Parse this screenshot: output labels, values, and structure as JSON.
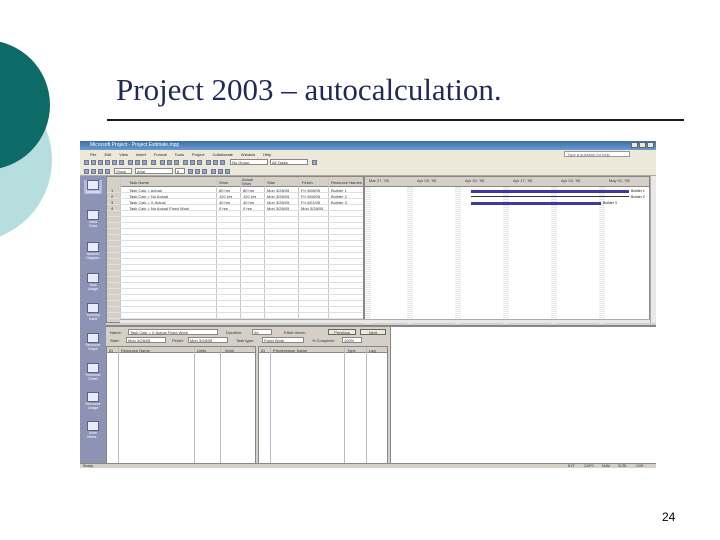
{
  "slide": {
    "title": "Project 2003 – autocalculation.",
    "page_number": "24"
  },
  "app": {
    "window_title": "Microsoft Project - Project Estimate.mpp",
    "menu": [
      "File",
      "Edit",
      "View",
      "Insert",
      "Format",
      "Tools",
      "Project",
      "Collaborate",
      "Window",
      "Help"
    ],
    "help_placeholder": "Type a question for help",
    "toolbar": {
      "group": "No Group",
      "filter": "All Tasks",
      "font": "Arial",
      "size": "8",
      "show": "Show"
    },
    "views": [
      "Calendar",
      "Gantt Chart",
      "Network Diagram",
      "Task Usage",
      "Tracking Gantt",
      "Resource Graph",
      "Resource Sheet",
      "Resource Usage",
      "More Views..."
    ],
    "task_table": {
      "columns": [
        "",
        "Task Name",
        "Work",
        "Actual Work",
        "Start",
        "Finish",
        "Resource Names"
      ],
      "rows": [
        [
          "1",
          "Task Calc = Actual",
          "80 hrs",
          "80 hrs",
          "Mon 3/28/05",
          "Fri 4/08/05",
          "Builder 1"
        ],
        [
          "2",
          "Task Calc = No Actual",
          "120 hrs",
          "120 hrs",
          "Mon 3/28/05",
          "Fri 4/08/05",
          "Builder 2"
        ],
        [
          "3",
          "Task Calc = X Actual",
          "40 hrs",
          "40 hrs",
          "Mon 3/28/05",
          "Fri 4/01/05",
          "Builder 3"
        ],
        [
          "4",
          "Task Calc = No Actual Fixed Work",
          "0 hrs",
          "0 hrs",
          "Mon 3/28/05",
          "Mon 3/28/05",
          ""
        ]
      ]
    },
    "gantt": {
      "weeks": [
        "Mar 27, '05",
        "Apr 03, '05",
        "Apr 10, '05",
        "Apr 17, '05",
        "Apr 24, '05",
        "May 01, '05"
      ],
      "bar_labels": [
        "Builder 1",
        "Builder 2",
        "Builder 3"
      ]
    },
    "form": {
      "name_label": "Name:",
      "name_value": "Task Calc = X Actual Fixed Work",
      "duration_label": "Duration:",
      "duration_value": "0d",
      "effort_label": "Effort driven",
      "previous": "Previous",
      "next": "Next",
      "start_label": "Start:",
      "start_value": "Mon 3/28/05",
      "finish_label": "Finish:",
      "finish_value": "Mon 3/28/05",
      "task_type_label": "Task type:",
      "task_type_value": "Fixed Work",
      "complete_label": "% Complete:",
      "complete_value": "100%",
      "left_columns": [
        "ID",
        "Resource Name",
        "Units",
        "Work"
      ],
      "right_columns": [
        "ID",
        "Predecessor Name",
        "Type",
        "Lag"
      ]
    },
    "status": {
      "left": "Ready",
      "indicators": [
        "EXT",
        "CAPS",
        "NUM",
        "SCRL",
        "OVR"
      ]
    }
  }
}
